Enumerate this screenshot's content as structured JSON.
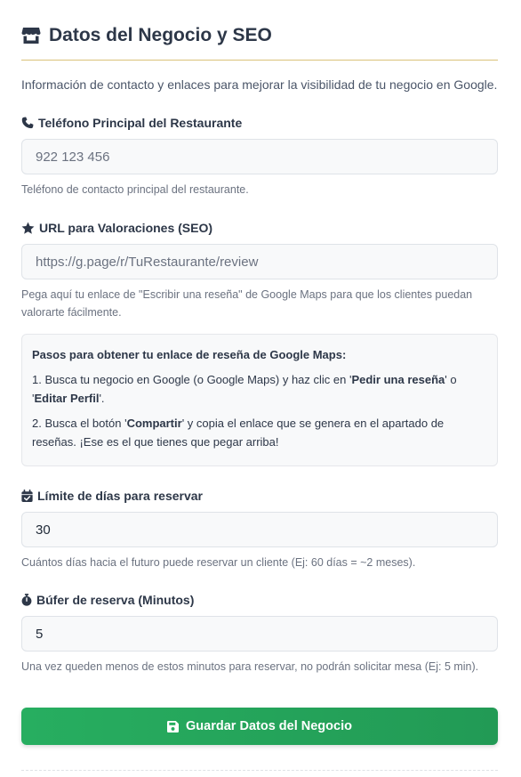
{
  "header": {
    "title": "Datos del Negocio y SEO",
    "icon": "store-icon"
  },
  "intro": "Información de contacto y enlaces para mejorar la visibilidad de tu negocio en Google.",
  "phone": {
    "icon": "phone-icon",
    "label": "Teléfono Principal del Restaurante",
    "placeholder": "922 123 456",
    "value": "",
    "help": "Teléfono de contacto principal del restaurante."
  },
  "reviews": {
    "icon": "star-icon",
    "label": "URL para Valoraciones (SEO)",
    "placeholder": "https://g.page/r/TuRestaurante/review",
    "value": "",
    "help": "Pega aquí tu enlace de \"Escribir una reseña\" de Google Maps para que los clientes puedan valorarte fácilmente."
  },
  "steps": {
    "title": "Pasos para obtener tu enlace de reseña de Google Maps:",
    "step1": {
      "a": "1. Busca tu negocio en Google (o Google Maps) y haz clic en '",
      "b": "Pedir una reseña",
      "c": "' o '",
      "d": "Editar Perfil",
      "e": "'."
    },
    "step2": {
      "a": "2. Busca el botón '",
      "b": "Compartir",
      "c": "' y copia el enlace que se genera en el apartado de reseñas. ¡Ese es el que tienes que pegar arriba!"
    }
  },
  "days_limit": {
    "icon": "calendar-check-icon",
    "label": "Límite de días para reservar",
    "value": "30",
    "help": "Cuántos días hacia el futuro puede reservar un cliente (Ej: 60 días = ~2 meses)."
  },
  "buffer": {
    "icon": "stopwatch-icon",
    "label": "Búfer de reserva (Minutos)",
    "value": "5",
    "help": "Una vez queden menos de estos minutos para reservar, no podrán solicitar mesa (Ej: 5 min)."
  },
  "save_button": {
    "label": "Guardar Datos del Negocio",
    "icon": "save-icon"
  },
  "colors": {
    "accent_green": "#27ae60",
    "header_rule": "#d9c27a",
    "heading": "#2d3748"
  }
}
